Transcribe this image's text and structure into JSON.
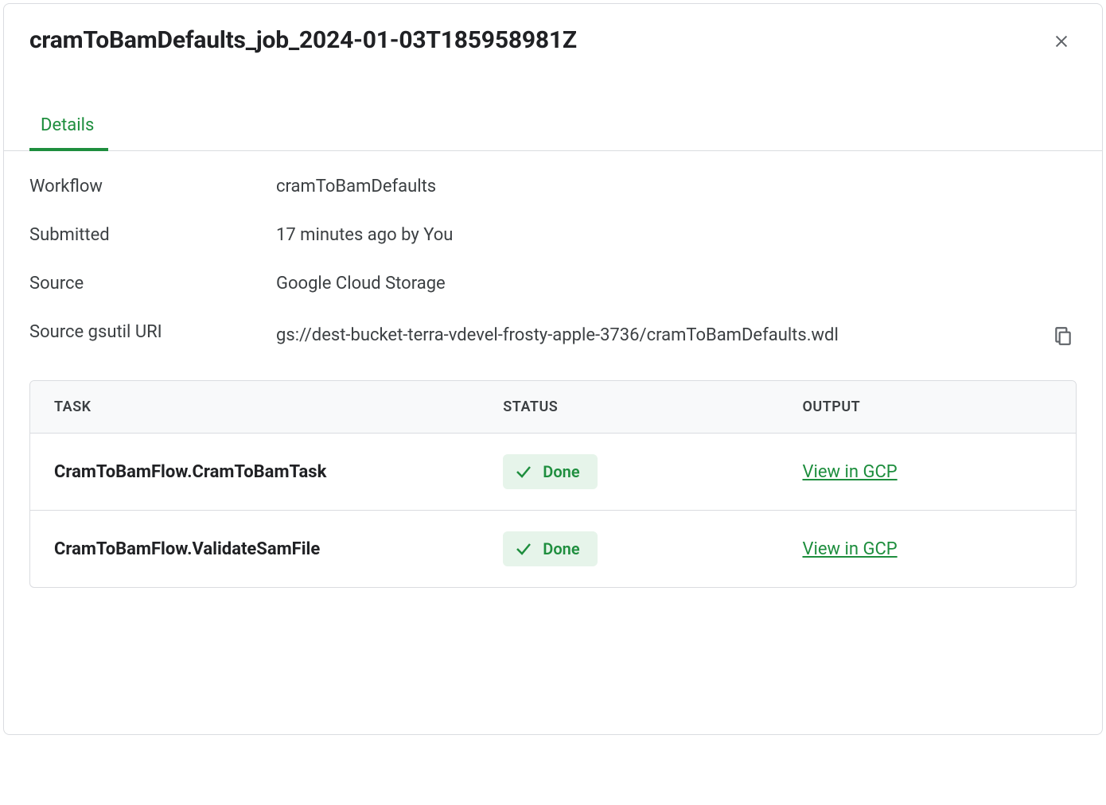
{
  "header": {
    "title": "cramToBamDefaults_job_2024-01-03T185958981Z"
  },
  "tabs": {
    "details_label": "Details"
  },
  "details": {
    "workflow_label": "Workflow",
    "workflow_value": "cramToBamDefaults",
    "submitted_label": "Submitted",
    "submitted_value": "17 minutes ago by You",
    "source_label": "Source",
    "source_value": "Google Cloud Storage",
    "uri_label": "Source gsutil URI",
    "uri_value": "gs://dest-bucket-terra-vdevel-frosty-apple-3736/cramToBamDefaults.wdl"
  },
  "table": {
    "headers": {
      "task": "TASK",
      "status": "STATUS",
      "output": "OUTPUT"
    },
    "rows": [
      {
        "task": "CramToBamFlow.CramToBamTask",
        "status": "Done",
        "output": "View in GCP"
      },
      {
        "task": "CramToBamFlow.ValidateSamFile",
        "status": "Done",
        "output": "View in GCP"
      }
    ]
  }
}
